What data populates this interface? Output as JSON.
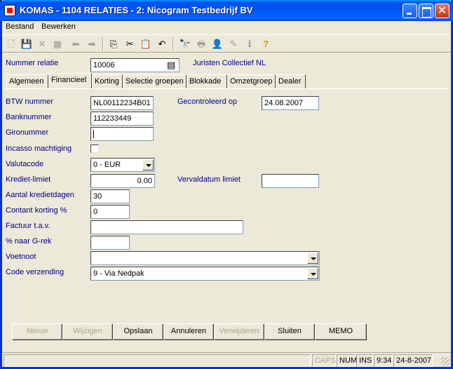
{
  "window": {
    "title": "KOMAS - 1104 RELATIES - 2: Nicogram Testbedrijf BV",
    "close_glyph": "✕"
  },
  "menu": [
    {
      "label": "Bestand"
    },
    {
      "label": "Bewerken"
    }
  ],
  "toolbar": [
    {
      "icon": "new-doc-icon",
      "glyph": "🗋",
      "enabled": false
    },
    {
      "icon": "save-icon",
      "glyph": "💾",
      "enabled": false
    },
    {
      "icon": "delete-icon",
      "glyph": "✕",
      "enabled": false
    },
    {
      "icon": "cancel-edit-icon",
      "glyph": "▦",
      "enabled": false
    },
    {
      "icon": "arrow-left-icon",
      "glyph": "⬅",
      "enabled": false
    },
    {
      "icon": "arrow-right-icon",
      "glyph": "➡",
      "enabled": false
    },
    {
      "icon": "copy-icon",
      "glyph": "⎘",
      "enabled": true
    },
    {
      "icon": "cut-icon",
      "glyph": "✂",
      "enabled": true
    },
    {
      "icon": "paste-icon",
      "glyph": "📋",
      "enabled": true
    },
    {
      "icon": "undo-icon",
      "glyph": "↶",
      "enabled": true
    },
    {
      "icon": "find-icon",
      "glyph": "🔭",
      "enabled": false
    },
    {
      "icon": "print-icon",
      "glyph": "🖶",
      "enabled": false
    },
    {
      "icon": "user-icon",
      "glyph": "👤",
      "enabled": false
    },
    {
      "icon": "check-icon",
      "glyph": "✎",
      "enabled": false
    },
    {
      "icon": "info-icon",
      "glyph": "ℹ",
      "enabled": false
    },
    {
      "icon": "help-icon",
      "glyph": "?",
      "enabled": true
    }
  ],
  "header": {
    "nummer_label": "Nummer relatie",
    "nummer_value": "10006",
    "lookup_glyph": "▤",
    "relation_name": "Juristen Collectief NL"
  },
  "tabs": [
    {
      "label": "Algemeen",
      "selected": false
    },
    {
      "label": "Financieel",
      "selected": true
    },
    {
      "label": "Korting",
      "selected": false
    },
    {
      "label": "Selectie groepen",
      "selected": false
    },
    {
      "label": "Blokkade",
      "selected": false
    },
    {
      "label": "Omzetgroep",
      "selected": false
    },
    {
      "label": "Dealer",
      "selected": false
    }
  ],
  "form": {
    "btw_label": "BTW nummer",
    "btw_value": "NL00112234B01",
    "gecontroleerd_label": "Gecontroleerd op",
    "gecontroleerd_value": "24.08.2007",
    "bank_label": "Banknummer",
    "bank_value": "112233449",
    "giro_label": "Gironummer",
    "giro_value": "",
    "incasso_label": "Incasso machtiging",
    "incasso_checked": false,
    "valuta_label": "Valutacode",
    "valuta_value": "0 - EUR",
    "krediet_label": "Krediet-limiet",
    "krediet_value": "0.00",
    "vervaldatum_label": "Vervaldatum limiet",
    "vervaldatum_value": "",
    "kredietdagen_label": "Aantal kredietdagen",
    "kredietdagen_value": "30",
    "contant_label": "Contant korting %",
    "contant_value": "0",
    "factuur_label": "Factuur t.a.v.",
    "factuur_value": "",
    "grek_label": "% naar G-rek",
    "grek_value": "",
    "voetnoot_label": "Voetnoot",
    "voetnoot_value": "",
    "verzending_label": "Code verzending",
    "verzending_value": "9 - Via Nedpak"
  },
  "buttons": [
    {
      "label": "Nieuw",
      "enabled": false
    },
    {
      "label": "Wijzigen",
      "enabled": false
    },
    {
      "label": "Opslaan",
      "enabled": true
    },
    {
      "label": "Annuleren",
      "enabled": true
    },
    {
      "label": "Verwijderen",
      "enabled": false
    },
    {
      "label": "Sluiten",
      "enabled": true
    },
    {
      "label": "MEMO",
      "enabled": true
    }
  ],
  "statusbar": {
    "caps": "CAPS",
    "num": "NUM",
    "ins": "INS",
    "time": "9:34",
    "date": "24-8-2007"
  }
}
